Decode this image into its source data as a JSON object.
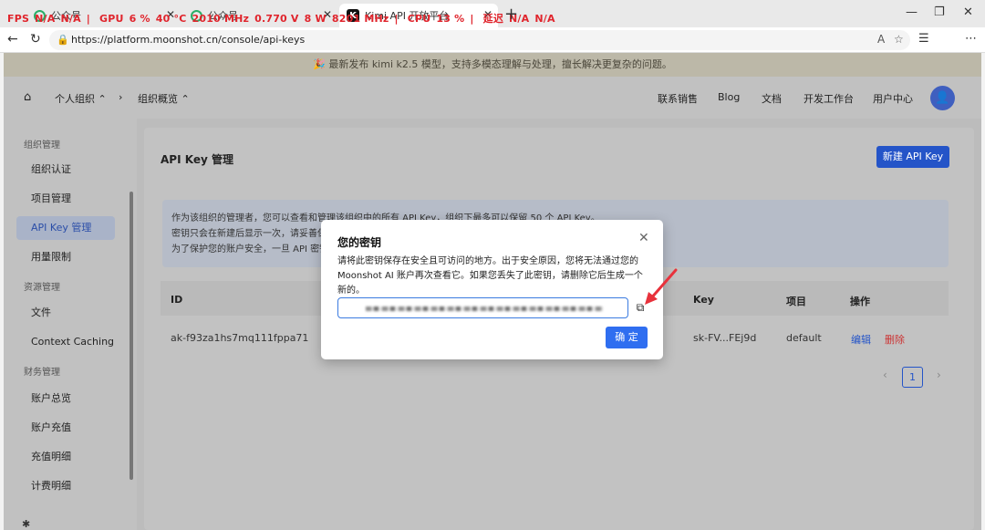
{
  "browser": {
    "tabs": [
      {
        "label": "公众号"
      },
      {
        "label": "公众号"
      },
      {
        "label": "Kimi API 开放平台"
      }
    ],
    "overlay_stats": [
      "FPS",
      "N/A",
      "N/A",
      "GPU",
      "6 %",
      "40 °C",
      "2010 MHz",
      "0.770 V",
      "8 W",
      "8201 MHz",
      "CPU",
      "13 %",
      "延迟",
      "N/A",
      "N/A"
    ],
    "url": "https://platform.moonshot.cn/console/api-keys"
  },
  "banner": {
    "text": "🎉 最新发布 kimi k2.5 模型，支持多模态理解与处理，擅长解决更复杂的问题。"
  },
  "header": {
    "crumbs": [
      "个人组织",
      "组织概览"
    ],
    "nav": [
      "联系销售",
      "Blog",
      "文档",
      "开发工作台",
      "用户中心"
    ]
  },
  "sidebar": {
    "groups": [
      "组织管理",
      "资源管理",
      "财务管理"
    ],
    "items": [
      "组织认证",
      "项目管理",
      "API Key 管理",
      "用量限制",
      "文件",
      "Context Caching",
      "账户总览",
      "账户充值",
      "充值明细",
      "计费明细"
    ]
  },
  "main": {
    "title": "API Key 管理",
    "new_key_label": "新建 API Key",
    "info_lines": [
      "作为该组织的管理者，您可以查看和管理该组织中的所有 API Key，组织下最多可以保留 50 个 API Key。",
      "密钥只会在新建后显示一次，请妥善保存。",
      "为了保护您的账户安全，一旦 API 密钥"
    ],
    "table": {
      "headers": [
        "ID",
        "Key",
        "项目",
        "操作"
      ],
      "row": {
        "id": "ak-f93za1hs7mq111fppa71",
        "key": "sk-FV...FEj9d",
        "project": "default",
        "edit": "编辑",
        "delete": "删除"
      }
    },
    "pager": {
      "prev": "‹",
      "current": "1",
      "next": "›"
    }
  },
  "modal": {
    "title": "您的密钥",
    "body": "请将此密钥保存在安全且可访问的地方。出于安全原因，您将无法通过您的 Moonshot AI 账户再次查看它。如果您丢失了此密钥，请删除它后生成一个新的。",
    "ok_label": "确 定"
  }
}
